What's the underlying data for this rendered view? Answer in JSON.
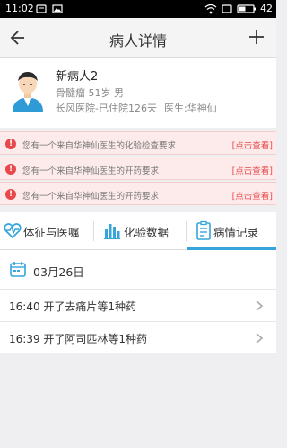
{
  "status_bar": {
    "time": "11:02",
    "battery": "42"
  },
  "header": {
    "title": "病人详情"
  },
  "patient": {
    "name": "新病人2",
    "info": "骨髓瘤 51岁 男",
    "hospital_stay": "长风医院-已住院126天",
    "doctor": "医生:华神仙"
  },
  "alerts": [
    {
      "text": "您有一个来自华神仙医生的化验检查要求",
      "link": "[点击查看]"
    },
    {
      "text": "您有一个来自华神仙医生的开药要求",
      "link": "[点击查看]"
    },
    {
      "text": "您有一个来自华神仙医生的开药要求",
      "link": "[点击查看]"
    }
  ],
  "tabs": [
    {
      "label": "体征与医嘱",
      "icon": "heartbeat-icon"
    },
    {
      "label": "化验数据",
      "icon": "bar-chart-icon"
    },
    {
      "label": "病情记录",
      "icon": "clipboard-icon",
      "active": true
    }
  ],
  "records": {
    "date": "03月26日",
    "items": [
      {
        "text": "16:40 开了去痛片等1种药"
      },
      {
        "text": "16:39 开了阿司匹林等1种药"
      }
    ]
  },
  "colors": {
    "accent": "#35a5dc",
    "alert": "#e8484a",
    "alert_bg": "#fdeaea"
  }
}
